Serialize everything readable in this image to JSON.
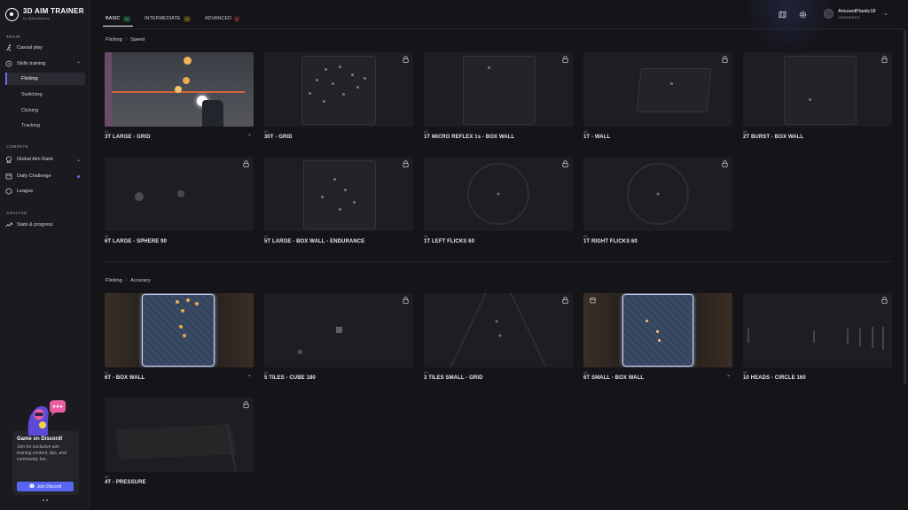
{
  "brand": {
    "title": "3D AIM TRAINER",
    "subtitle": "by @stealtharios"
  },
  "sidebar": {
    "train_label": "TRAIN",
    "compete_label": "COMPETE",
    "analyze_label": "ANALYZE",
    "items": {
      "casual": "Casual play",
      "skills": "Skills training",
      "flicking": "Flicking",
      "switching": "Switching",
      "clicking": "Clicking",
      "tracking": "Tracking",
      "global_rank": "Global Aim Rank",
      "daily": "Daily Challenge",
      "league": "League",
      "stats": "Stats & progress"
    },
    "discord": {
      "title": "Game on Discord!",
      "text": "Join for exclusive aim training content, tips, and community fun.",
      "button": "Join Discord"
    }
  },
  "tabs": [
    {
      "label": "BASIC",
      "count": "15"
    },
    {
      "label": "INTERMEDIATE",
      "count": "12"
    },
    {
      "label": "ADVANCED",
      "count": "8"
    }
  ],
  "user": {
    "name": "AmusedPlastic18",
    "rank": "UNRANKED"
  },
  "sections": [
    {
      "crumb": [
        "Flicking",
        "Speed"
      ],
      "cards": [
        {
          "num": "#1",
          "title": "3T LARGE - GRID"
        },
        {
          "num": "#2",
          "title": "30T - GRID"
        },
        {
          "num": "#3",
          "title": "1T MICRO REFLEX 1s - BOX WALL"
        },
        {
          "num": "#4",
          "title": "1T - WALL"
        },
        {
          "num": "#5",
          "title": "2T BURST - BOX WALL"
        },
        {
          "num": "#6",
          "title": "6T LARGE - SPHERE 90"
        },
        {
          "num": "#7",
          "title": "5T LARGE - BOX WALL - ENDURANCE"
        },
        {
          "num": "#8",
          "title": "1T LEFT FLICKS 60"
        },
        {
          "num": "#9",
          "title": "1T RIGHT FLICKS 60"
        }
      ]
    },
    {
      "crumb": [
        "Flicking",
        "Accuracy"
      ],
      "cards": [
        {
          "num": "#1",
          "title": "6T - BOX WALL"
        },
        {
          "num": "#2",
          "title": "5 TILES - CUBE 180"
        },
        {
          "num": "#3",
          "title": "3 TILES SMALL - GRID"
        },
        {
          "num": "#4",
          "title": "6T SMALL - BOX WALL"
        },
        {
          "num": "#5",
          "title": "10 HEADS - CIRCLE 160"
        },
        {
          "num": "#6",
          "title": "4T - PRESSURE"
        }
      ]
    }
  ],
  "colors": {
    "accent": "#5864f2",
    "bg": "#141419",
    "sidebar": "#1a1a20"
  }
}
